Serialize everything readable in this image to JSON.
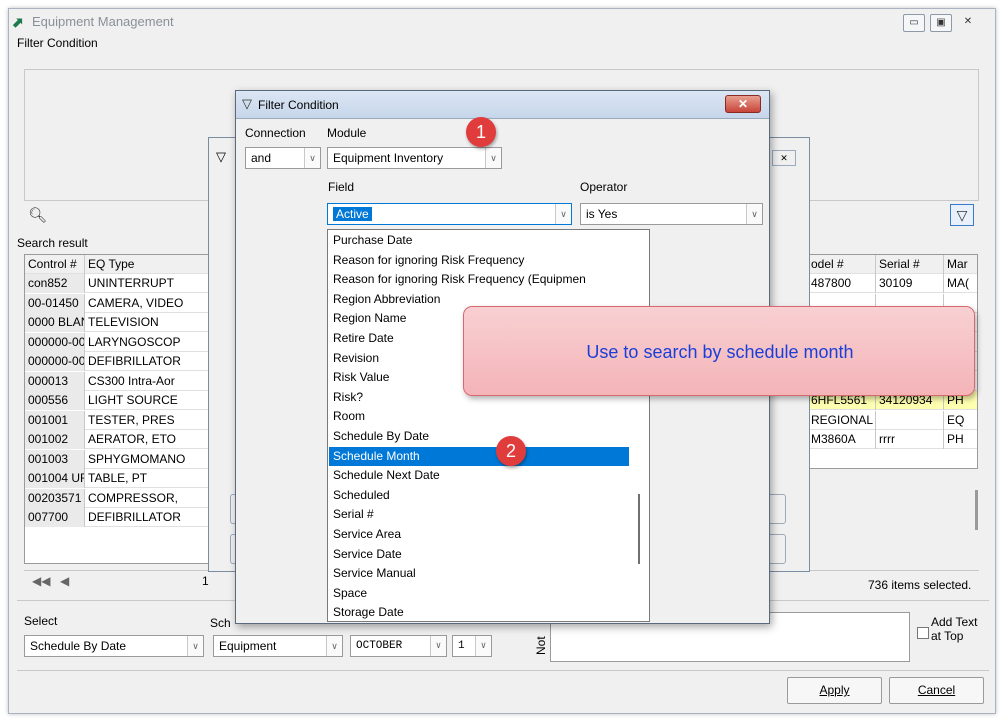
{
  "window": {
    "title": "Equipment Management",
    "minimize": "▭",
    "maximize": "▣",
    "close": "✕"
  },
  "filter_condition": {
    "label": "Filter Condition"
  },
  "search_result": {
    "label": "Search result",
    "columns_left": [
      "Control #",
      "EQ Type"
    ],
    "rows_left": [
      [
        "con852",
        "UNINTERRUPT"
      ],
      [
        "00-01450",
        "CAMERA, VIDEO"
      ],
      [
        "0000 BLAN",
        "TELEVISION"
      ],
      [
        "000000-00",
        "LARYNGOSCOP"
      ],
      [
        "000000-00",
        "DEFIBRILLATOR"
      ],
      [
        "000013",
        "CS300 Intra-Aor"
      ],
      [
        "000556",
        "LIGHT SOURCE"
      ],
      [
        "001001",
        "TESTER, PRES"
      ],
      [
        "001002",
        "AERATOR, ETO"
      ],
      [
        "001003",
        "SPHYGMOMANO"
      ],
      [
        "001004 UF",
        "TABLE, PT"
      ],
      [
        "00203571",
        "COMPRESSOR,"
      ],
      [
        "007700",
        "DEFIBRILLATOR"
      ]
    ],
    "columns_right": [
      "odel #",
      "Serial #",
      "Mar"
    ],
    "rows_right": [
      [
        "487800",
        "30109",
        "MA("
      ],
      [
        "",
        "",
        ""
      ],
      [
        "",
        "",
        ""
      ],
      [
        "",
        "",
        ""
      ],
      [
        "",
        "",
        ""
      ],
      [
        "",
        "",
        ""
      ],
      [
        "6HFL5561",
        "34120934",
        "PH"
      ],
      [
        "REGIONAL",
        "",
        "EQ"
      ],
      [
        "M3860A",
        "rrrr",
        "PH"
      ]
    ],
    "items_selected": "736 items selected.",
    "page_indicator": "1"
  },
  "bottom": {
    "select_label": "Select",
    "select_value": "Schedule By Date",
    "schedule_label": "Sch",
    "equipment_value": "Equipment",
    "month_value": "OCTOBER",
    "day_value": "1",
    "note_label": "Not",
    "add_text_label": "Add Text at Top",
    "apply_label": "Apply",
    "cancel_label": "Cancel"
  },
  "dialog": {
    "title": "Filter Condition",
    "connection_label": "Connection",
    "module_label": "Module",
    "connection_value": "and",
    "module_value": "Equipment Inventory",
    "field_label": "Field",
    "operator_label": "Operator",
    "field_value": "Active",
    "operator_value": "is Yes",
    "field_options": [
      "Purchase Date",
      "Reason for ignoring Risk Frequency",
      "Reason for ignoring Risk Frequency (Equipmen",
      "Region Abbreviation",
      "Region Name",
      "Retire Date",
      "Revision",
      "Risk Value",
      "Risk?",
      "Room",
      "Schedule By Date",
      "Schedule Month",
      "Schedule Next Date",
      "Scheduled",
      "Serial #",
      "Service Area",
      "Service Date",
      "Service Manual",
      "Space",
      "Storage Date"
    ],
    "selected_option": "Schedule Month"
  },
  "callout": {
    "text": "Use to search by schedule month"
  },
  "badges": [
    "1",
    "2"
  ]
}
